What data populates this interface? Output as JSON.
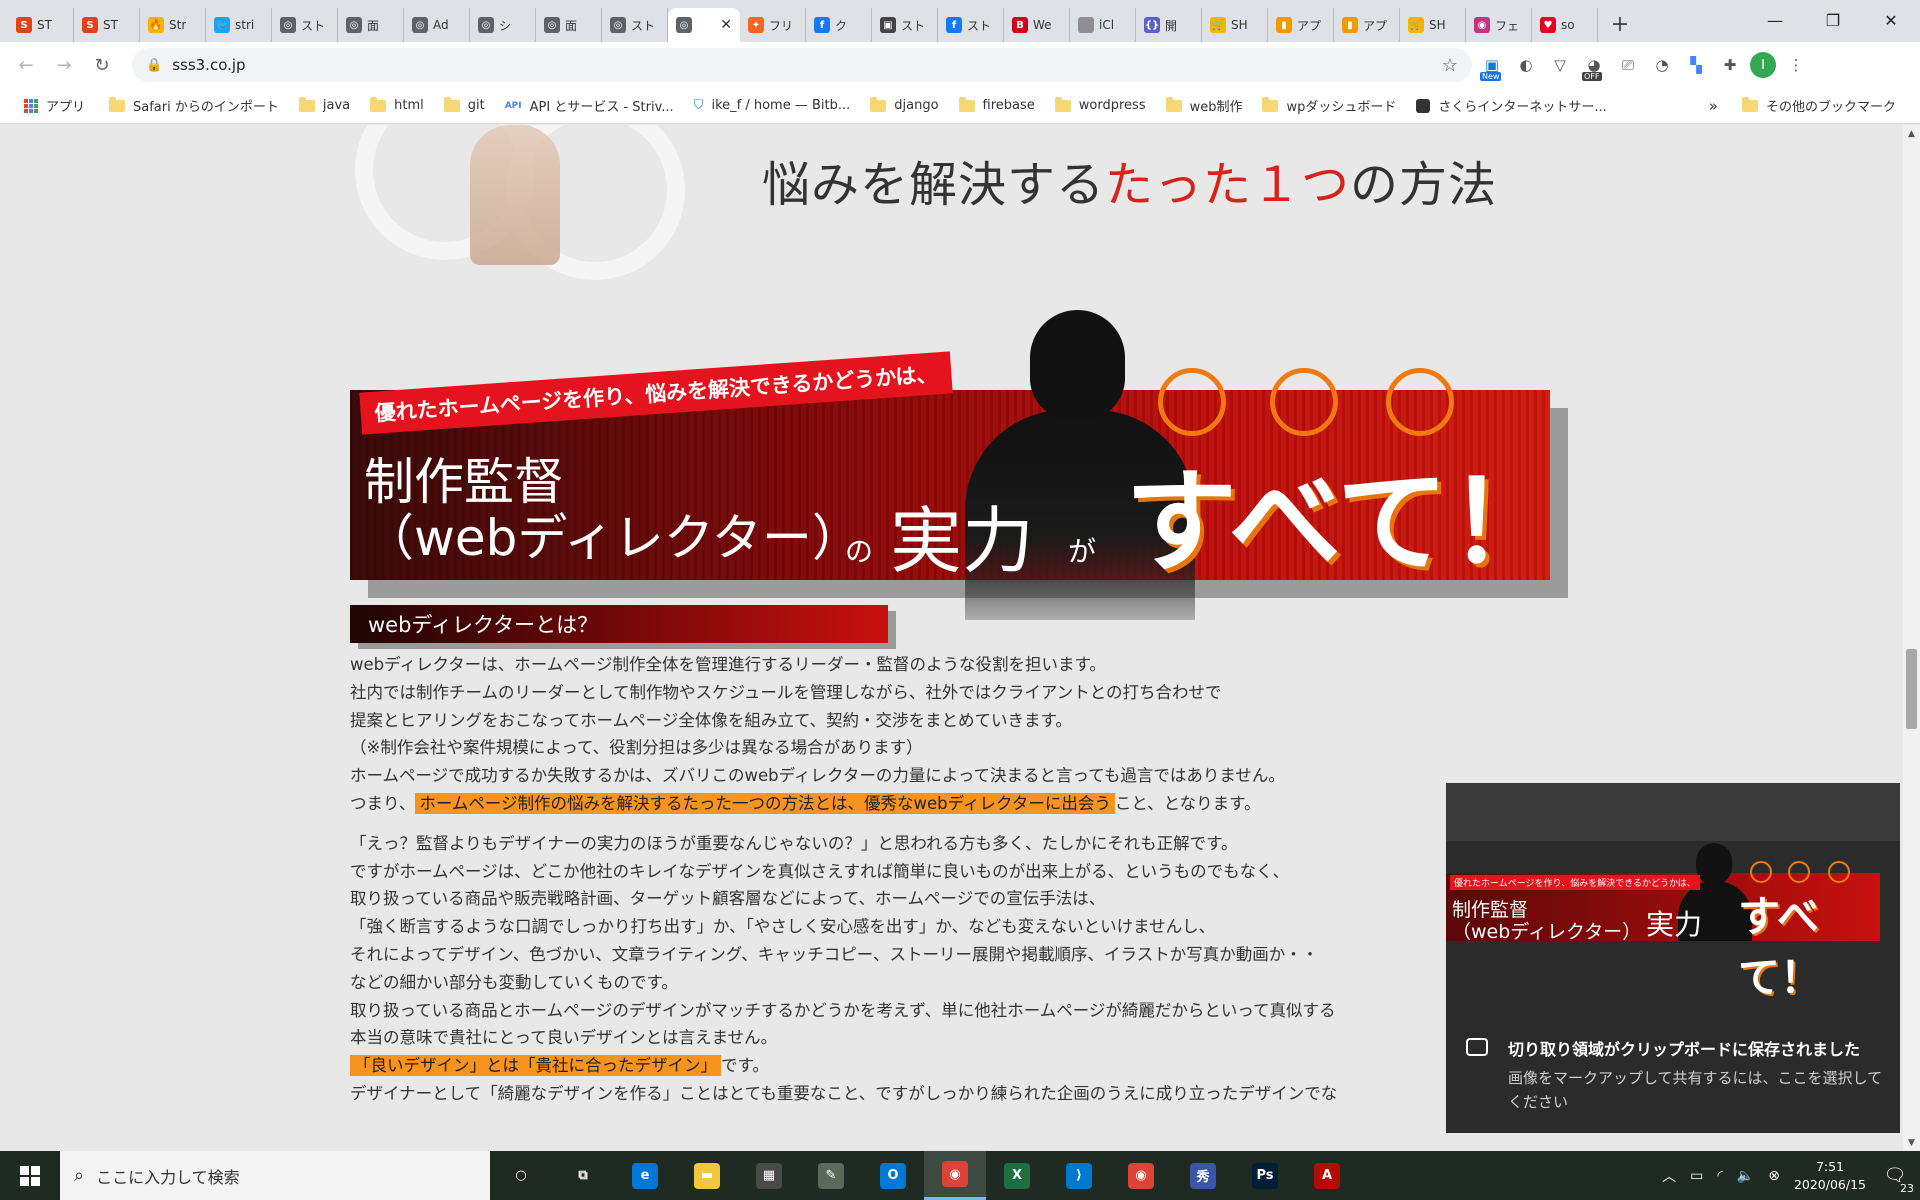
{
  "browser": {
    "tabs": [
      {
        "label": "ST",
        "favicon": "S",
        "color": "#e2421b"
      },
      {
        "label": "ST",
        "favicon": "S",
        "color": "#e2421b"
      },
      {
        "label": "Str",
        "favicon": "🔥",
        "color": "#f5b400"
      },
      {
        "label": "stri",
        "favicon": "🐦",
        "color": "#1da1f2"
      },
      {
        "label": "スト",
        "favicon": "◎",
        "color": "#5f6368"
      },
      {
        "label": "面",
        "favicon": "◎",
        "color": "#5f6368"
      },
      {
        "label": "Ad",
        "favicon": "◎",
        "color": "#5f6368"
      },
      {
        "label": "シ",
        "favicon": "◎",
        "color": "#5f6368"
      },
      {
        "label": "面",
        "favicon": "◎",
        "color": "#5f6368"
      },
      {
        "label": "スト",
        "favicon": "◎",
        "color": "#5f6368"
      },
      {
        "label": "",
        "favicon": "◎",
        "color": "#5f6368",
        "active": true
      },
      {
        "label": "フリ",
        "favicon": "✦",
        "color": "#f26522"
      },
      {
        "label": "ク",
        "favicon": "f",
        "color": "#1877f2"
      },
      {
        "label": "スト",
        "favicon": "▣",
        "color": "#444444"
      },
      {
        "label": "スト",
        "favicon": "f",
        "color": "#1877f2"
      },
      {
        "label": "We",
        "favicon": "B",
        "color": "#d6001c"
      },
      {
        "label": "iCl",
        "favicon": "",
        "color": "#8e8e93"
      },
      {
        "label": "開",
        "favicon": "{}",
        "color": "#5b5fc7"
      },
      {
        "label": "SH",
        "favicon": "🛒",
        "color": "#f5b400"
      },
      {
        "label": "アプ",
        "favicon": "▮",
        "color": "#f29900"
      },
      {
        "label": "アプ",
        "favicon": "▮",
        "color": "#f29900"
      },
      {
        "label": "SH",
        "favicon": "🛒",
        "color": "#f5b400"
      },
      {
        "label": "フェ",
        "favicon": "◉",
        "color": "#c13584"
      },
      {
        "label": "so",
        "favicon": "♥",
        "color": "#e60023"
      }
    ],
    "new_tab": "+",
    "window_controls": {
      "minimize": "—",
      "maximize": "❐",
      "close": "✕"
    },
    "url": "sss3.co.jp",
    "ext_new_badge": "New",
    "ext_off_badge": "OFF",
    "profile_initial": "I"
  },
  "bookmarks": {
    "apps": "アプリ",
    "items": [
      "Safari からのインポート",
      "java",
      "html",
      "git",
      "API とサービス - Striv...",
      "ike_f / home — Bitb...",
      "django",
      "firebase",
      "wordpress",
      "web制作",
      "wpダッシュボード",
      "さくらインターネットサー..."
    ],
    "api_prefix": "API",
    "more": "»",
    "other": "その他のブックマーク"
  },
  "page": {
    "hero": {
      "part1": "悩みを解決する",
      "part2": "たった１つ",
      "part3": "の方法"
    },
    "banner": {
      "ribbon": "優れたホームページを作り、悩みを解決できるかどうかは、",
      "line1": "制作監督",
      "line2": "（webディレクター）",
      "no": "の",
      "jitsu": "実力",
      "ga": "が",
      "subete": "すべて！"
    },
    "section_heading": "webディレクターとは？",
    "paragraph1": [
      "webディレクターは、ホームページ制作全体を管理進行するリーダー・監督のような役割を担います。",
      "社内では制作チームのリーダーとして制作物やスケジュールを管理しながら、社外ではクライアントとの打ち合わせで",
      "提案とヒアリングをおこなってホームページ全体像を組み立て、契約・交渉をまとめていきます。",
      "（※制作会社や案件規模によって、役割分担は多少は異なる場合があります）",
      "ホームページで成功するか失敗するかは、ズバリこのwebディレクターの力量によって決まると言っても過言ではありません。"
    ],
    "conclusion": {
      "before": "つまり、",
      "highlight": "ホームページ制作の悩みを解決するたった一つの方法とは、優秀なwebディレクターに出会う",
      "after": "こと、となります。"
    },
    "paragraph2": [
      "「えっ？監督よりもデザイナーの実力のほうが重要なんじゃないの？」と思われる方も多く、たしかにそれも正解です。",
      "ですがホームページは、どこか他社のキレイなデザインを真似さえすれば簡単に良いものが出来上がる、というものでもなく、",
      "取り扱っている商品や販売戦略計画、ターゲット顧客層などによって、ホームページでの宣伝手法は、",
      "「強く断言するような口調でしっかり打ち出す」か、「やさしく安心感を出す」か、なども変えないといけませんし、",
      "それによってデザイン、色づかい、文章ライティング、キャッチコピー、ストーリー展開や掲載順序、イラストか写真か動画か・・",
      "などの細かい部分も変動していくものです。",
      "取り扱っている商品とホームページのデザインがマッチするかどうかを考えず、単に他社ホームページが綺麗だからといって真似する",
      "本当の意味で貴社にとって良いデザインとは言えません。"
    ],
    "good_design": {
      "highlight": "「良いデザイン」とは「貴社に合ったデザイン」",
      "after": "です。"
    },
    "last_line": "デザイナーとして「綺麗なデザインを作る」ことはとても重要なこと、ですがしっかり練られた企画のうえに成り立ったデザインでな"
  },
  "notification": {
    "title": "切り取り領域がクリップボードに保存されました",
    "body": "画像をマークアップして共有するには、ここを選択してください"
  },
  "taskbar": {
    "search_placeholder": "ここに入力して検索",
    "time": "7:51",
    "date": "2020/06/15",
    "notification_count": "23",
    "apps": [
      {
        "name": "cortana-icon",
        "glyph": "○",
        "color": "transparent"
      },
      {
        "name": "task-view-icon",
        "glyph": "⧉",
        "color": "transparent"
      },
      {
        "name": "edge-icon",
        "glyph": "e",
        "color": "#0078d7"
      },
      {
        "name": "explorer-icon",
        "glyph": "▬",
        "color": "#f3c640"
      },
      {
        "name": "store-icon",
        "glyph": "▦",
        "color": "#4a4a4a"
      },
      {
        "name": "app-icon",
        "glyph": "✎",
        "color": "#5a6a5a"
      },
      {
        "name": "outlook-icon",
        "glyph": "O",
        "color": "#0078d4"
      },
      {
        "name": "chrome-icon",
        "glyph": "◉",
        "color": "#db4437",
        "active": true
      },
      {
        "name": "excel-icon",
        "glyph": "X",
        "color": "#1d6f42"
      },
      {
        "name": "vscode-icon",
        "glyph": "⟩",
        "color": "#007acc"
      },
      {
        "name": "chrome-icon-2",
        "glyph": "◉",
        "color": "#db4437"
      },
      {
        "name": "manga-app-icon",
        "glyph": "秀",
        "color": "#3b55a8"
      },
      {
        "name": "photoshop-icon",
        "glyph": "Ps",
        "color": "#001e36"
      },
      {
        "name": "acrobat-icon",
        "glyph": "A",
        "color": "#b30b00"
      }
    ]
  }
}
